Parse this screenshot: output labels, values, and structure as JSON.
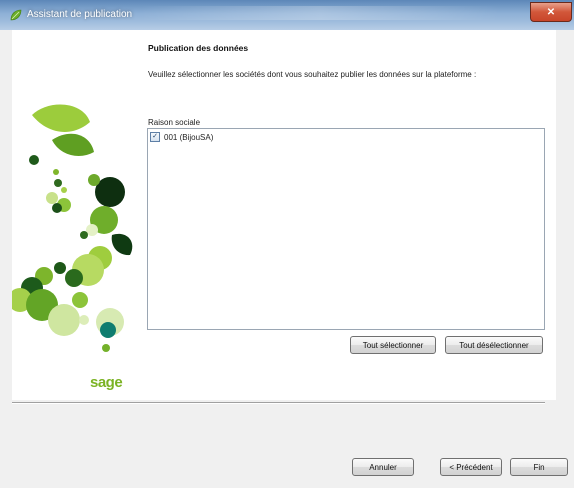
{
  "window": {
    "title": "Assistant de publication",
    "close_glyph": "✕",
    "titlebar_color": "#8eb0d6"
  },
  "side_panel": {
    "logo_text": "sage",
    "accent_color": "#7bb324"
  },
  "content": {
    "heading": "Publication des données",
    "description": "Veuillez sélectionner les sociétés dont vous souhaitez publier les données sur la plateforme :",
    "list_label": "Raison sociale",
    "companies": [
      {
        "label": "001 (BijouSA)",
        "checked": true
      }
    ],
    "select_all_label": "Tout sélectionner",
    "deselect_all_label": "Tout désélectionner"
  },
  "footer": {
    "cancel_label": "Annuler",
    "previous_label": "< Précédent",
    "finish_label": "Fin"
  },
  "icons": {
    "app": "leaf-icon",
    "close": "close-icon",
    "check": "check-icon"
  }
}
